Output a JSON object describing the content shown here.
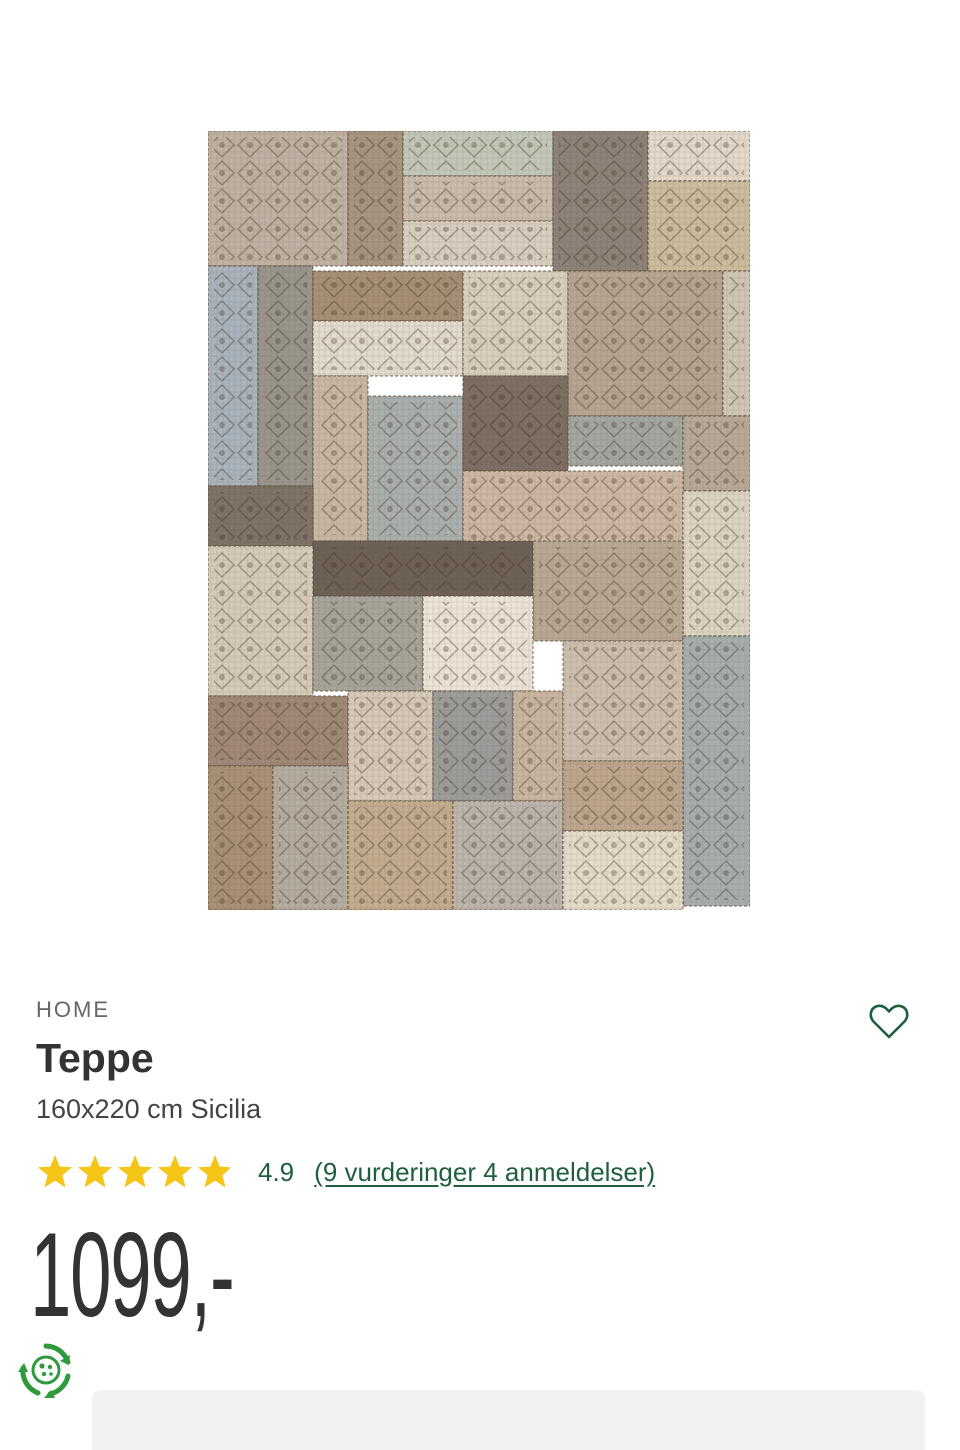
{
  "product": {
    "brand": "HOME",
    "title": "Teppe",
    "subtitle": "160x220 cm Sicilia",
    "rating": "4.9",
    "rating_stars": 4.9,
    "reviews_link": "(9 vurderinger 4 anmeldelser)",
    "price": "1099,-"
  },
  "icons": {
    "favorite": "heart-outline-icon",
    "eco": "recycle-eco-icon",
    "star": "star-icon"
  },
  "colors": {
    "accent": "#1f5f3e",
    "star": "#f5c518",
    "star_empty": "#dddddd",
    "eco_green": "#2f9a3c"
  }
}
